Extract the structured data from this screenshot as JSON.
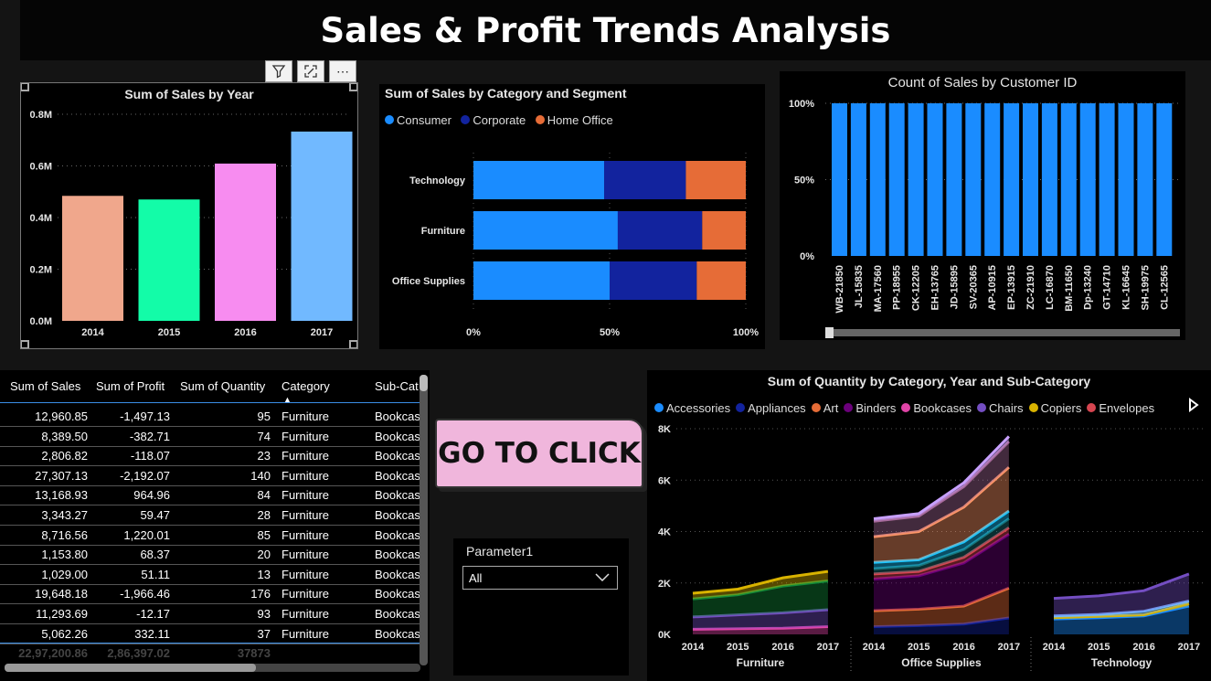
{
  "page_title": "Sales & Profit Trends Analysis",
  "visual_header": {
    "filter_icon": "filter-icon",
    "focus_icon": "focus-mode-icon",
    "more_label": "⋯"
  },
  "sales_by_year": {
    "title": "Sum of Sales by Year",
    "yticks": [
      "0.8M",
      "0.6M",
      "0.4M",
      "0.2M",
      "0.0M"
    ],
    "colors": [
      "#f0a78c",
      "#13fca8",
      "#f78cf0",
      "#71b9ff"
    ]
  },
  "sales_by_category_segment": {
    "title": "Sum of Sales by Category and Segment",
    "legend": [
      {
        "label": "Consumer",
        "color": "#1a8cff"
      },
      {
        "label": "Corporate",
        "color": "#12239e"
      },
      {
        "label": "Home Office",
        "color": "#e66c37"
      }
    ],
    "xticks": [
      "0%",
      "50%",
      "100%"
    ]
  },
  "count_by_customer": {
    "title": "Count of Sales by Customer ID",
    "yticks": [
      "100%",
      "50%",
      "0%"
    ]
  },
  "quantity_chart": {
    "title": "Sum of Quantity by Category, Year and Sub-Category",
    "legend": [
      {
        "label": "Accessories",
        "color": "#1a8cff"
      },
      {
        "label": "Appliances",
        "color": "#12239e"
      },
      {
        "label": "Art",
        "color": "#e66c37"
      },
      {
        "label": "Binders",
        "color": "#6b007b"
      },
      {
        "label": "Bookcases",
        "color": "#e044a7"
      },
      {
        "label": "Chairs",
        "color": "#744ec2"
      },
      {
        "label": "Copiers",
        "color": "#d9b300"
      },
      {
        "label": "Envelopes",
        "color": "#d64550"
      }
    ],
    "yticks": [
      "8K",
      "6K",
      "4K",
      "2K",
      "0K"
    ],
    "years": [
      "2014",
      "2015",
      "2016",
      "2017"
    ],
    "groups": [
      "Furniture",
      "Office Supplies",
      "Technology"
    ]
  },
  "table": {
    "headers": [
      "Sum of Sales",
      "Sum of Profit",
      "Sum of Quantity",
      "Category",
      "Sub-Cat"
    ],
    "rows": [
      [
        "12,960.85",
        "-1,497.13",
        "95",
        "Furniture",
        "Bookcas"
      ],
      [
        "8,389.50",
        "-382.71",
        "74",
        "Furniture",
        "Bookcas"
      ],
      [
        "2,806.82",
        "-118.07",
        "23",
        "Furniture",
        "Bookcas"
      ],
      [
        "27,307.13",
        "-2,192.07",
        "140",
        "Furniture",
        "Bookcas"
      ],
      [
        "13,168.93",
        "964.96",
        "84",
        "Furniture",
        "Bookcas"
      ],
      [
        "3,343.27",
        "59.47",
        "28",
        "Furniture",
        "Bookcas"
      ],
      [
        "8,716.56",
        "1,220.01",
        "85",
        "Furniture",
        "Bookcas"
      ],
      [
        "1,153.80",
        "68.37",
        "20",
        "Furniture",
        "Bookcas"
      ],
      [
        "1,029.00",
        "51.11",
        "13",
        "Furniture",
        "Bookcas"
      ],
      [
        "19,648.18",
        "-1,966.46",
        "176",
        "Furniture",
        "Bookcas"
      ],
      [
        "11,293.69",
        "-12.17",
        "93",
        "Furniture",
        "Bookcas"
      ],
      [
        "5,062.26",
        "332.11",
        "37",
        "Furniture",
        "Bookcas"
      ]
    ],
    "totals": [
      "22,97,200.86",
      "2,86,397.02",
      "37873"
    ]
  },
  "button": {
    "label": "GO TO CLICK"
  },
  "parameter": {
    "label": "Parameter1",
    "value": "All"
  },
  "chart_data": [
    {
      "type": "bar",
      "title": "Sum of Sales by Year",
      "categories": [
        "2014",
        "2015",
        "2016",
        "2017"
      ],
      "values": [
        484000,
        470000,
        609000,
        733000
      ],
      "ylim": [
        0,
        800000
      ],
      "grid": true
    },
    {
      "type": "bar",
      "title": "Sum of Sales by Category and Segment",
      "orientation": "horizontal-100%-stacked",
      "categories": [
        "Technology",
        "Furniture",
        "Office Supplies"
      ],
      "series": [
        {
          "name": "Consumer",
          "values": [
            48,
            53,
            50
          ]
        },
        {
          "name": "Corporate",
          "values": [
            30,
            31,
            32
          ]
        },
        {
          "name": "Home Office",
          "values": [
            22,
            16,
            18
          ]
        }
      ],
      "legend": "top-left"
    },
    {
      "type": "bar",
      "title": "Count of Sales by Customer ID",
      "categories": [
        "WB-21850",
        "JL-15835",
        "MA-17560",
        "PP-18955",
        "CK-12205",
        "EH-13765",
        "JD-15895",
        "SV-20365",
        "AP-10915",
        "EP-13915",
        "ZC-21910",
        "LC-16870",
        "BM-11650",
        "Dp-13240",
        "GT-14710",
        "KL-16645",
        "SH-19975",
        "CL-12565"
      ],
      "values": [
        100,
        100,
        100,
        100,
        100,
        100,
        100,
        100,
        100,
        100,
        100,
        100,
        100,
        100,
        100,
        100,
        100,
        100
      ],
      "ylim": [
        0,
        100
      ]
    },
    {
      "type": "area",
      "title": "Sum of Quantity by Category, Year and Sub-Category",
      "stacked": true,
      "ylim": [
        0,
        8000
      ],
      "x": [
        "2014",
        "2015",
        "2016",
        "2017"
      ],
      "groups": [
        {
          "name": "Furniture",
          "layers": [
            {
              "color": "#e044a7",
              "values": [
                200,
                220,
                240,
                300
              ]
            },
            {
              "color": "#744ec2",
              "values": [
                680,
                760,
                840,
                960
              ]
            },
            {
              "color": "#118a3a",
              "values": [
                1380,
                1540,
                1880,
                2080
              ]
            },
            {
              "color": "#d9b300",
              "values": [
                1600,
                1760,
                2200,
                2450
              ]
            }
          ]
        },
        {
          "name": "Office Supplies",
          "layers": [
            {
              "color": "#12239e",
              "values": [
                300,
                340,
                400,
                640
              ]
            },
            {
              "color": "#e66c37",
              "values": [
                920,
                980,
                1100,
                1800
              ]
            },
            {
              "color": "#6b007b",
              "values": [
                2150,
                2280,
                2780,
                3900
              ]
            },
            {
              "color": "#d64550",
              "values": [
                2350,
                2450,
                3000,
                4150
              ]
            },
            {
              "color": "#197278",
              "values": [
                2550,
                2680,
                3300,
                4500
              ]
            },
            {
              "color": "#1ac6ff",
              "values": [
                2800,
                2900,
                3600,
                4800
              ]
            },
            {
              "color": "#fe9666",
              "values": [
                3800,
                4000,
                4950,
                6500
              ]
            },
            {
              "color": "#a66999",
              "values": [
                4400,
                4600,
                5750,
                7500
              ]
            },
            {
              "color": "#c8a0ff",
              "values": [
                4500,
                4700,
                5900,
                7700
              ]
            }
          ]
        },
        {
          "name": "Technology",
          "layers": [
            {
              "color": "#1a8cff",
              "values": [
                600,
                650,
                720,
                1100
              ]
            },
            {
              "color": "#d9b300",
              "values": [
                650,
                700,
                760,
                1200
              ]
            },
            {
              "color": "#71b9ff",
              "values": [
                720,
                780,
                900,
                1300
              ]
            },
            {
              "color": "#744ec2",
              "values": [
                1400,
                1500,
                1700,
                2350
              ]
            }
          ]
        }
      ]
    }
  ]
}
